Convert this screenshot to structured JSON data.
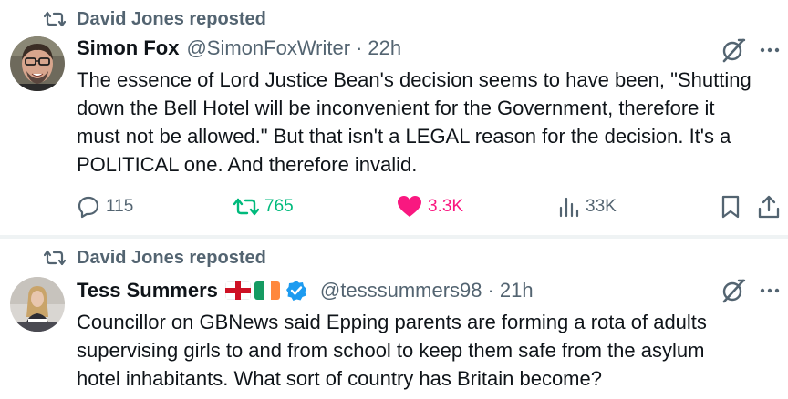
{
  "posts": [
    {
      "repost_label": "David Jones reposted",
      "author_name": "Simon Fox",
      "handle": "@SimonFoxWriter",
      "separator": "·",
      "time": "22h",
      "lines": [
        "The essence of Lord Justice Bean's decision seems to have been, \"Shutting",
        "down the Bell Hotel will be inconvenient for the Government, therefore it",
        "must not be allowed.\" But that isn't a LEGAL reason for the decision. It's a",
        "POLITICAL one. And therefore invalid."
      ],
      "replies": "115",
      "reposts": "765",
      "likes": "3.3K",
      "views": "33K"
    },
    {
      "repost_label": "David Jones reposted",
      "author_name": "Tess Summers",
      "handle": "@tesssummers98",
      "separator": "·",
      "time": "21h",
      "lines": [
        "Councillor on GBNews said Epping parents are forming a rota of adults",
        "supervising girls to and from school to keep them safe from the asylum",
        "hotel inhabitants. What sort of country has Britain become?"
      ]
    }
  ],
  "colors": {
    "text": "#0f1419",
    "secondary": "#536471",
    "repost_green": "#00ba7c",
    "like_pink": "#f91880",
    "verified_blue": "#1d9bf0",
    "divider": "#eff3f4"
  }
}
